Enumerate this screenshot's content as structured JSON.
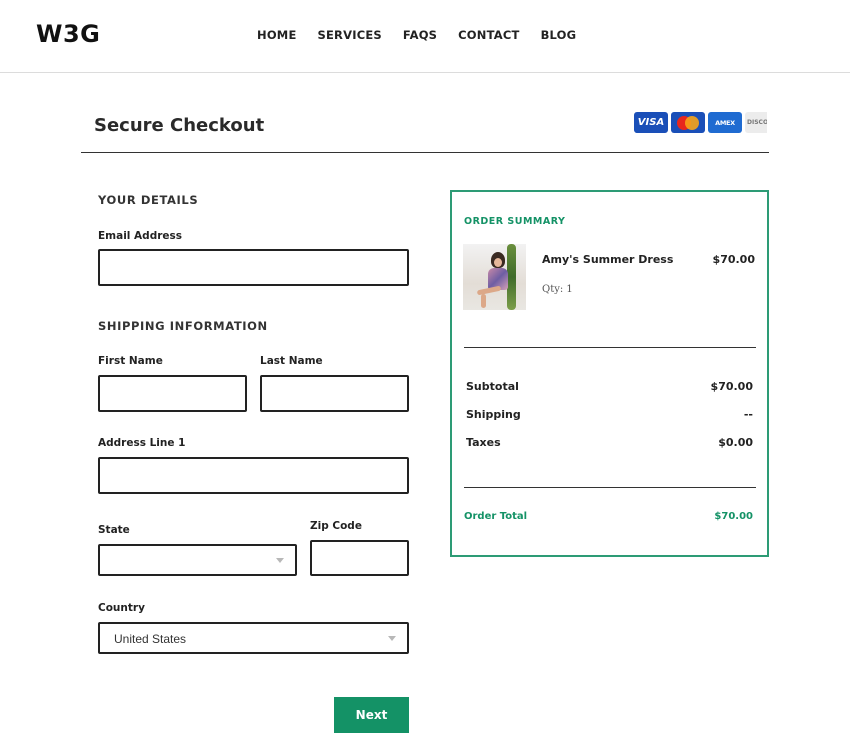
{
  "header": {
    "logo": "W3G",
    "nav": [
      "HOME",
      "SERVICES",
      "FAQS",
      "CONTACT",
      "BLOG"
    ]
  },
  "checkout": {
    "title": "Secure Checkout",
    "cards": [
      "VISA",
      "AMEX",
      "DISCOVER"
    ]
  },
  "details": {
    "section_title": "YOUR DETAILS",
    "email_label": "Email Address",
    "email_value": ""
  },
  "shipping": {
    "section_title": "SHIPPING INFORMATION",
    "first_name_label": "First Name",
    "last_name_label": "Last Name",
    "address_label": "Address Line 1",
    "state_label": "State",
    "state_value": "",
    "zip_label": "Zip Code",
    "country_label": "Country",
    "country_value": "United States"
  },
  "next_label": "Next",
  "summary": {
    "title": "ORDER SUMMARY",
    "product_name": "Amy's Summer Dress",
    "product_price": "$70.00",
    "qty": "Qty: 1",
    "subtotal_label": "Subtotal",
    "subtotal_value": "$70.00",
    "shipping_label": "Shipping",
    "shipping_value": "--",
    "taxes_label": "Taxes",
    "taxes_value": "$0.00",
    "total_label": "Order Total",
    "total_value": "$70.00"
  },
  "colors": {
    "accent": "#149266",
    "border": "#2d9b75"
  }
}
